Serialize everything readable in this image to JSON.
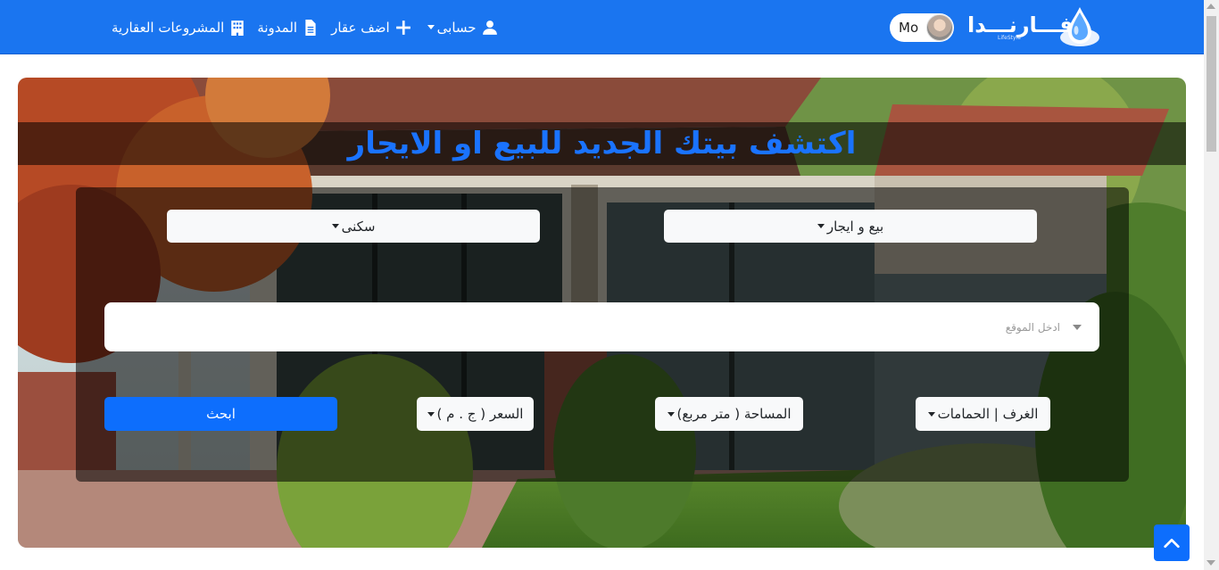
{
  "nav": {
    "projects_label": "المشروعات العقارية",
    "blog_label": "المدونة",
    "add_property_label": "اضف عقار",
    "account_label": "حسابى",
    "user_name": "Mo",
    "logo_text": "فـــارنـــدا",
    "logo_sub": "LifeStyle"
  },
  "hero": {
    "title": "اكتشف بيتك الجديد للبيع او الايجار"
  },
  "search": {
    "listing_type": "بيع و ايجار",
    "property_category": "سكنى",
    "location_placeholder": "ادخل الموقع",
    "rooms_label": "الغرف | الحمامات",
    "area_label": "المساحة ( متر مربع)",
    "price_label": "السعر ( ج . م )",
    "search_button": "ابحث"
  },
  "colors": {
    "brand": "#1a75f0",
    "accent": "#0d6efd",
    "title": "#1a73ff"
  },
  "icons": {
    "projects": "building-icon",
    "blog": "file-icon",
    "add_property": "plus-icon",
    "account": "user-icon",
    "back_to_top": "chevron-up-icon"
  }
}
